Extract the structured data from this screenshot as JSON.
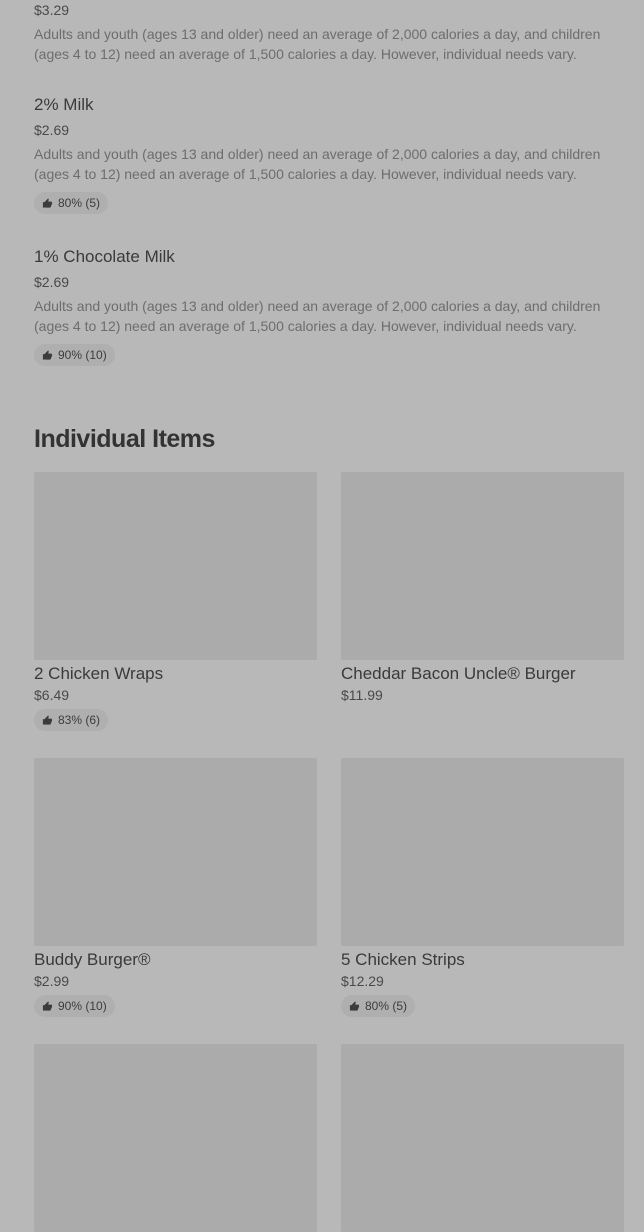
{
  "colors": {
    "background": "#b8b8b8",
    "image_placeholder": "#ababab",
    "badge_bg": "#afafaf",
    "text_primary": "#3a3a3a",
    "text_secondary": "#6d6d6d"
  },
  "list_items": [
    {
      "price": "$3.29",
      "description": "Adults and youth (ages 13 and older) need an average of 2,000 calories a day, and children (ages 4 to 12) need an average of 1,500 calories a day. However, individual needs vary."
    },
    {
      "name": "2% Milk",
      "price": "$2.69",
      "description": "Adults and youth (ages 13 and older) need an average of 2,000 calories a day, and children (ages 4 to 12) need an average of 1,500 calories a day. However, individual needs vary.",
      "rating": "80% (5)"
    },
    {
      "name": "1% Chocolate Milk",
      "price": "$2.69",
      "description": "Adults and youth (ages 13 and older) need an average of 2,000 calories a day, and children (ages 4 to 12) need an average of 1,500 calories a day. However, individual needs vary.",
      "rating": "90% (10)"
    }
  ],
  "section": {
    "title": "Individual Items"
  },
  "cards": [
    {
      "name": "2 Chicken Wraps",
      "price": "$6.49",
      "rating": "83% (6)"
    },
    {
      "name": "Cheddar Bacon Uncle® Burger",
      "price": "$11.99"
    },
    {
      "name": "Buddy Burger®",
      "price": "$2.99",
      "rating": "90% (10)"
    },
    {
      "name": "5 Chicken Strips",
      "price": "$12.29",
      "rating": "80% (5)"
    }
  ],
  "icons": {
    "rating": "thumbs-up-icon"
  }
}
